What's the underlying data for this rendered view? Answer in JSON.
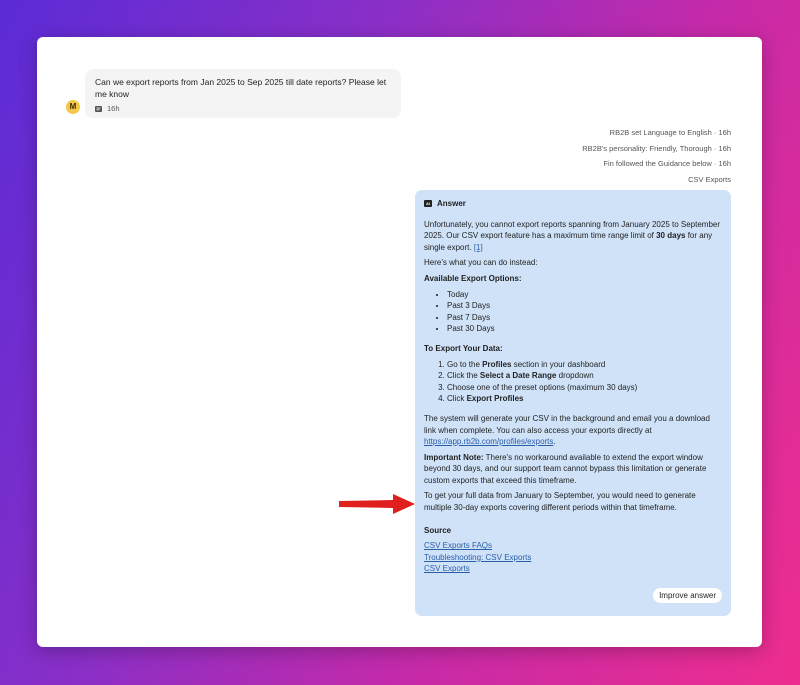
{
  "user_message": {
    "avatar_initial": "M",
    "text": "Can we export reports from Jan 2025 to Sep 2025 till date reports? Please let me know",
    "time": "16h"
  },
  "events": [
    "RB2B set Language to English · 16h",
    "RB2B's personality: Friendly, Thorough · 16h",
    "Fin followed the Guidance below · 16h",
    "CSV Exports"
  ],
  "answer": {
    "icon_label": "AI",
    "heading": "Answer",
    "intro_1": "Unfortunately, you cannot export reports spanning from January 2025 to September 2025. Our CSV export feature has a maximum time range limit of ",
    "intro_bold": "30 days",
    "intro_2": " for any single export. ",
    "intro_ref": "[1]",
    "alt_line": "Here's what you can do instead:",
    "options_title": "Available Export Options:",
    "options": [
      "Today",
      "Past 3 Days",
      "Past 7 Days",
      "Past 30 Days"
    ],
    "steps_title": "To Export Your Data:",
    "steps": [
      {
        "pre": "Go to the ",
        "bold": "Profiles",
        "post": " section in your dashboard"
      },
      {
        "pre": "Click the ",
        "bold": "Select a Date Range",
        "post": " dropdown"
      },
      {
        "pre": "Choose one of the preset options (maximum 30 days)",
        "bold": "",
        "post": ""
      },
      {
        "pre": "Click ",
        "bold": "Export Profiles",
        "post": ""
      }
    ],
    "system_text": "The system will generate your CSV in the background and email you a download link when complete. You can also access your exports directly at ",
    "exports_link": "https://app.rb2b.com/profiles/exports",
    "system_end": ".",
    "note_label": "Important Note:",
    "note_text": " There's no workaround available to extend the export window beyond 30 days, and our support team cannot bypass this limitation or generate custom exports that exceed this timeframe.",
    "full_data_text": "To get your full data from January to September, you would need to generate multiple 30-day exports covering different periods within that timeframe.",
    "source_title": "Source",
    "sources": [
      "CSV Exports FAQs",
      "Troubleshooting: CSV Exports",
      "CSV Exports"
    ],
    "improve_label": "Improve answer"
  },
  "colors": {
    "answer_bg": "#cfe2f8",
    "link": "#2a5ea8",
    "arrow": "#e0201f",
    "avatar": "#f3c84a"
  }
}
